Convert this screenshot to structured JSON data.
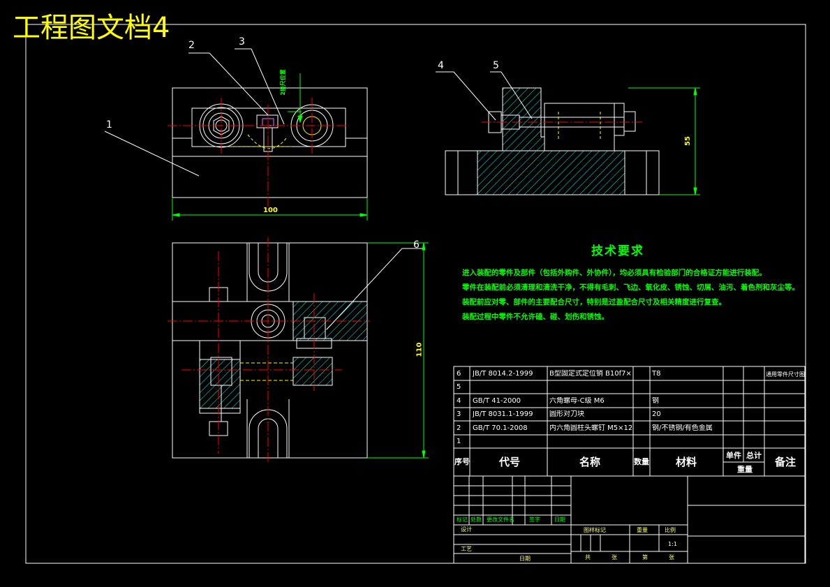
{
  "title": "工程图文档4",
  "part_labels": [
    "1",
    "2",
    "3",
    "4",
    "5",
    "6"
  ],
  "dims": {
    "width_100": "100",
    "height_55": "55",
    "height_110": "110"
  },
  "rotated_note": "2接尺位置",
  "tech": {
    "heading": "技术要求",
    "lines": [
      "进入装配的零件及部件（包括外购件、外协件），均必须具有检验部门的合格证方能进行装配。",
      "零件在装配前必须清理和清洗干净，不得有毛刺、飞边、氧化皮、锈蚀、切屑、油污、着色剂和灰尘等。",
      "装配前应对零、部件的主要配合尺寸，特别是过盈配合尺寸及相关精度进行复查。",
      "装配过程中零件不允许磕、碰、划伤和锈蚀。"
    ]
  },
  "bom": {
    "rows": [
      {
        "no": "6",
        "code": "JB/T 8014.2-1999",
        "name": "B型固定式定位销 B10f7×14",
        "qty": "",
        "mat": "T8",
        "remark": "通用零件尺寸图纸"
      },
      {
        "no": "5",
        "code": "",
        "name": "",
        "qty": "",
        "mat": "",
        "remark": ""
      },
      {
        "no": "4",
        "code": "GB/T 41-2000",
        "name": "六角螺母-C级 M6",
        "qty": "",
        "mat": "钢",
        "remark": ""
      },
      {
        "no": "3",
        "code": "JB/T 8031.1-1999",
        "name": "圆形对刀块",
        "qty": "",
        "mat": "20",
        "remark": ""
      },
      {
        "no": "2",
        "code": "GB/T 70.1-2008",
        "name": "内六角圆柱头螺钉 M5×12",
        "qty": "",
        "mat": "钢/不锈钢/有色金属",
        "remark": ""
      },
      {
        "no": "1",
        "code": "",
        "name": "",
        "qty": "",
        "mat": "",
        "remark": ""
      }
    ],
    "header": {
      "no": "序号",
      "code": "代号",
      "name": "名称",
      "qty": "数量",
      "mat": "材料",
      "unit": "单件",
      "total": "总计",
      "weight": "重量",
      "remark": "备注"
    }
  },
  "titleblock": {
    "mark": "标记",
    "count": "处数",
    "file": "更改文件名",
    "sign": "签字",
    "date": "日期",
    "design": "设计",
    "process": "工艺",
    "date2": "日期",
    "stage": "图样标记",
    "weight": "重量",
    "scale": "比例",
    "scale_value": "1:1",
    "total_sheets": "共",
    "sheet_no": "张",
    "of": "第",
    "sheet2": "张"
  },
  "colors": {
    "outline": "#ffffff",
    "center": "#ff0000",
    "hatch": "#00ffff",
    "dim": "#00ff00",
    "hidden": "#ffff00",
    "title": "#ffff00"
  }
}
